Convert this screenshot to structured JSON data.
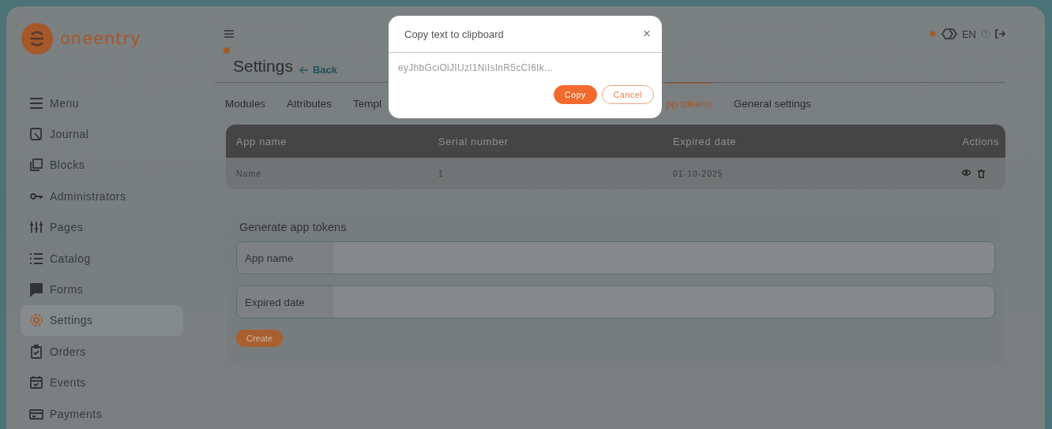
{
  "logo": "oneentry",
  "topbar": {
    "language": "EN"
  },
  "sidebar": {
    "items": [
      {
        "label": "Menu",
        "selected": false
      },
      {
        "label": "Journal",
        "selected": false
      },
      {
        "label": "Blocks",
        "selected": false
      },
      {
        "label": "Administrators",
        "selected": false
      },
      {
        "label": "Pages",
        "selected": false
      },
      {
        "label": "Catalog",
        "selected": false
      },
      {
        "label": "Forms",
        "selected": false
      },
      {
        "label": "Settings",
        "selected": true
      },
      {
        "label": "Orders",
        "selected": false
      },
      {
        "label": "Events",
        "selected": false
      },
      {
        "label": "Payments",
        "selected": false
      }
    ]
  },
  "header": {
    "title": "Settings",
    "back": "Back"
  },
  "tabs": [
    {
      "label": "Modules",
      "selected": false
    },
    {
      "label": "Attributes",
      "selected": false
    },
    {
      "label": "Templ",
      "selected": false
    },
    {
      "label": "pp tokens",
      "selected": true
    },
    {
      "label": "General settings",
      "selected": false
    }
  ],
  "table": {
    "columns": [
      "App name",
      "Serial number",
      "Expired date",
      "Actions"
    ],
    "rows": [
      {
        "cells": [
          "Name",
          "1",
          "01-10-2025"
        ]
      }
    ]
  },
  "generate": {
    "title": "Generate app tokens",
    "fields": [
      {
        "label": "App name"
      },
      {
        "label": "Expired date"
      }
    ],
    "button": "Create"
  },
  "dialog": {
    "title": "Copy text to clipboard",
    "close": "×",
    "text": "eyJhbGciOiJIUzI1NiIsInR5cCI6Ik...",
    "buttons": [
      {
        "label": "Copy",
        "kind": "primary"
      },
      {
        "label": "Cancel",
        "kind": "secondary"
      }
    ]
  }
}
